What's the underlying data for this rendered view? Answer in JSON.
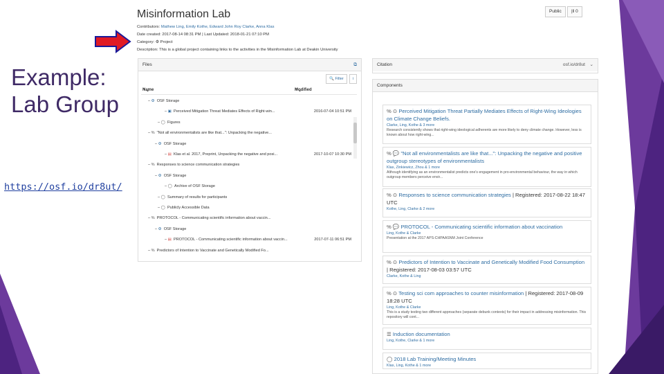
{
  "slide": {
    "title_line1": "Example:",
    "title_line2": "Lab Group",
    "link": "https://osf.io/dr8ut/",
    "colors": {
      "title": "#3f2a66",
      "accent_purple": "#5b2d8e",
      "arrow": "#e01b24"
    }
  },
  "project": {
    "title": "Misinformation Lab",
    "public_label": "Public",
    "fork_label": "|ǁ 0",
    "contributors_label": "Contributors:",
    "contributors": "Mathew Ling, Emily Kothe, Edward John Roy Clarke, Anna Klas",
    "date_line": "Date created: 2017-08-14 08:31 PM | Last Updated: 2018-01-21 07:10 PM",
    "category_label": "Category:",
    "category_value": "Project",
    "description": "Description: This is a global project containing links to the activities in the Misinformation Lab at Deakin University"
  },
  "files": {
    "header": "Files",
    "filter_label": "Filter",
    "col_name": "Name",
    "col_modified": "Modified",
    "rows": [
      {
        "name": "OSF Storage",
        "modified": "",
        "icon": "storage-icon"
      },
      {
        "name": "Perceived Mitigation Threat Mediates Effects of Right-win...",
        "modified": "2016-07-04 10:51 PM",
        "icon": "file-icon"
      },
      {
        "name": "Figures",
        "modified": "",
        "icon": "folder-icon"
      },
      {
        "name": "\"Not all environmentalists are like that...\": Unpacking the negative...",
        "modified": "",
        "icon": "link-icon"
      },
      {
        "name": "OSF Storage",
        "modified": "",
        "icon": "storage-icon"
      },
      {
        "name": "Klas et al. 2017, Preprint, Unpacking the negative and posi...",
        "modified": "2017-10-07 10:30 PM",
        "icon": "pdf-icon"
      },
      {
        "name": "Responses to science communication strategies",
        "modified": "",
        "icon": "link-icon"
      },
      {
        "name": "OSF Storage",
        "modified": "",
        "icon": "storage-icon"
      },
      {
        "name": "Archive of OSF Storage",
        "modified": "",
        "icon": "folder-icon"
      },
      {
        "name": "Summary of results for participants",
        "modified": "",
        "icon": "folder-icon"
      },
      {
        "name": "Publicly Accessible Data",
        "modified": "",
        "icon": "folder-icon"
      },
      {
        "name": "PROTOCOL - Communicating scientific information about vaccin...",
        "modified": "",
        "icon": "link-icon"
      },
      {
        "name": "OSF Storage",
        "modified": "",
        "icon": "storage-icon"
      },
      {
        "name": "PROTOCOL - Communicating scientific information about vaccin...",
        "modified": "2017-07-11 06:51 PM",
        "icon": "pdf-icon"
      },
      {
        "name": "Predictors of Intention to Vaccinate and Genetically Modified Fo...",
        "modified": "",
        "icon": "link-icon"
      }
    ]
  },
  "citation": {
    "header": "Citation",
    "value": "osf.io/dr8ut"
  },
  "components": {
    "header": "Components",
    "items": [
      {
        "title": "Perceived Mitigation Threat Partially Mediates Effects of Right-Wing Ideologies on Climate Change Beliefs.",
        "registered": "",
        "contribs": "Clarke, Ling, Kothe & 3 more",
        "desc": "Research consistently shows that right-wing ideological adherents are more likely to deny climate change. However, less is known about how right-wing..."
      },
      {
        "title": "\"Not all environmentalists are like that...\": Unpacking the negative and positive outgroup stereotypes of environmentalists",
        "registered": "",
        "contribs": "Klas, Zinkiewicz, Zhou & 1 more",
        "desc": "Although identifying as an environmentalist predicts one's engagement in pro-environmental behaviour, the way in which outgroup members perceive envir..."
      },
      {
        "title": "Responses to science communication strategies",
        "registered": "| Registered: 2017-08-22 18:47 UTC",
        "contribs": "Kothe, Ling, Clarke & 2 more",
        "desc": ""
      },
      {
        "title": "PROTOCOL - Communicating scientific information about vaccination",
        "registered": "",
        "contribs": "Ling, Kothe & Clarke",
        "desc": "Presentation at the 2017 APS-CHPAASNM Joint Conference"
      },
      {
        "title": "Predictors of Intention to Vaccinate and Genetically Modified Food Consumption",
        "registered": "| Registered: 2017-08-03 03:57 UTC",
        "contribs": "Clarke, Kothe & Ling",
        "desc": ""
      },
      {
        "title": "Testing sci com approaches to counter misinformation",
        "registered": "| Registered: 2017-08-09 18:28 UTC",
        "contribs": "Ling, Kothe & Clarke",
        "desc": "This is a study testing two different approaches (separate debunk contexts) for their impact in addressing misinformation. This repository will cont..."
      },
      {
        "title": "Induction documentation",
        "registered": "",
        "contribs": "Ling, Kothe, Clarke & 1 more",
        "desc": ""
      },
      {
        "title": "2018 Lab Training/Meeting Minutes",
        "registered": "",
        "contribs": "Klas, Ling, Kothe & 1 more",
        "desc": ""
      }
    ]
  }
}
